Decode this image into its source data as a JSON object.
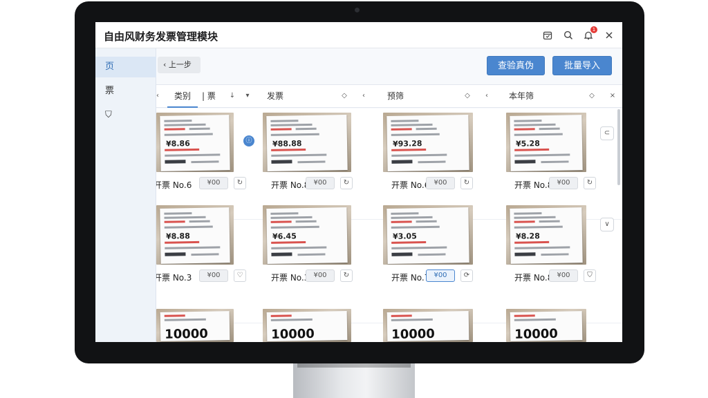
{
  "app_title": "自由风财务发票管理模块",
  "titlebar_icons": [
    "calendar-icon",
    "search-icon",
    "bell-icon",
    "close-icon"
  ],
  "notification_count": "1",
  "sidebar": {
    "items": [
      {
        "label": "页"
      },
      {
        "label": "票"
      },
      {
        "label": "⛉"
      }
    ]
  },
  "toolbar": {
    "back_label": "上一步",
    "verify_label": "查验真伪",
    "import_label": "批量导入"
  },
  "columns": [
    {
      "label": "类别",
      "sort": "▾"
    },
    {
      "label": "| 票",
      "sort": "↓"
    },
    {
      "label": "发票",
      "sort": "◇"
    },
    {
      "label": "预筛",
      "sort": "◇"
    },
    {
      "label": "本年筛",
      "sort": "◇"
    }
  ],
  "accent_color": "#4a86cf",
  "cards": [
    {
      "label": "开票 No.6",
      "amount": "¥00",
      "action_icon": "rotate-icon",
      "doc_no": "¥8.86"
    },
    {
      "label": "开票 No.8",
      "amount": "¥00",
      "action_icon": "rotate-icon",
      "doc_no": "¥88.88"
    },
    {
      "label": "开票 No.6",
      "amount": "¥00",
      "action_icon": "rotate-icon",
      "doc_no": "¥93.28"
    },
    {
      "label": "开票 No.8",
      "amount": "¥00",
      "action_icon": "rotate-icon",
      "doc_no": "¥5.28"
    },
    {
      "label": "开票 No.3",
      "amount": "¥00",
      "action_icon": "heart-icon",
      "doc_no": "¥8.88"
    },
    {
      "label": "开票 No.3",
      "amount": "¥00",
      "action_icon": "rotate-icon",
      "doc_no": "¥6.45"
    },
    {
      "label": "开票 No.7",
      "amount": "¥00",
      "action_icon": "refresh-icon",
      "doc_no": "¥3.05"
    },
    {
      "label": "开票 No.8",
      "amount": "¥00",
      "action_icon": "shield-icon",
      "doc_no": "¥8.28"
    },
    {
      "label": "",
      "amount": "",
      "action_icon": "",
      "doc_no": "10000"
    },
    {
      "label": "",
      "amount": "",
      "action_icon": "",
      "doc_no": "10000"
    },
    {
      "label": "",
      "amount": "",
      "action_icon": "",
      "doc_no": "10000"
    },
    {
      "label": "",
      "amount": "",
      "action_icon": "",
      "doc_no": "10000"
    }
  ]
}
